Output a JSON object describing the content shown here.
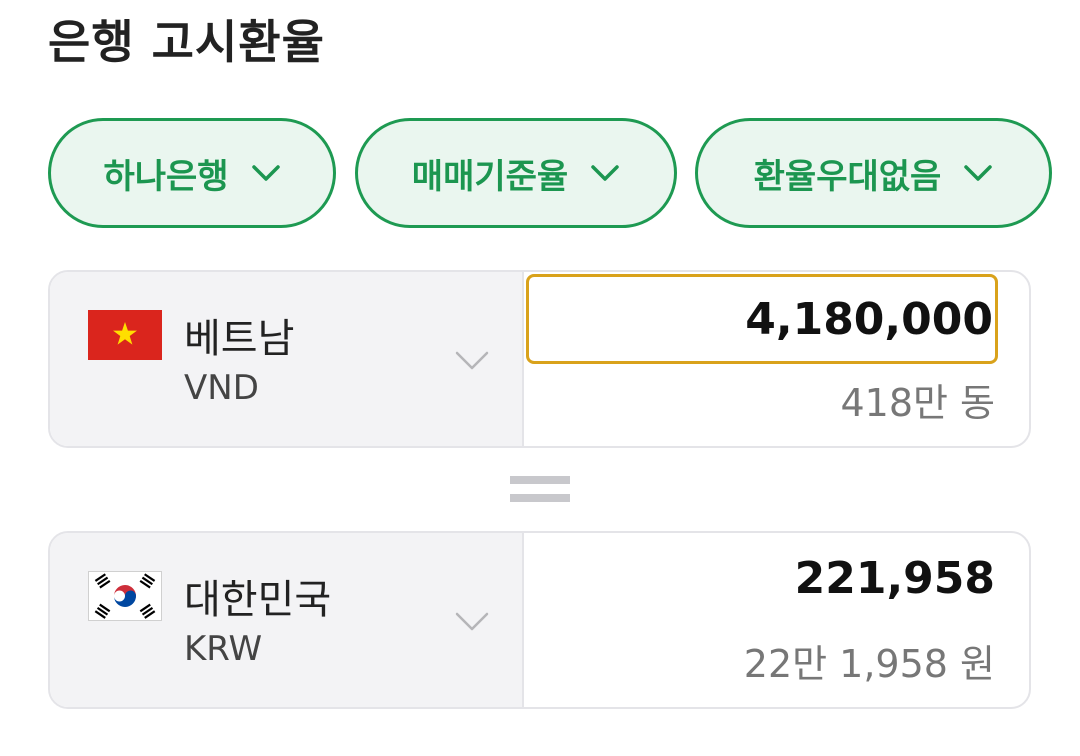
{
  "page": {
    "title": "은행 고시환율"
  },
  "filters": [
    {
      "label": "하나은행",
      "icon": "chevron-down-icon"
    },
    {
      "label": "매매기준율",
      "icon": "chevron-down-icon"
    },
    {
      "label": "환율우대없음",
      "icon": "chevron-down-icon"
    }
  ],
  "from": {
    "country": "베트남",
    "code": "VND",
    "flag_icon": "vietnam-flag-icon",
    "amount": "4,180,000",
    "amount_text": "418만 동"
  },
  "to": {
    "country": "대한민국",
    "code": "KRW",
    "flag_icon": "korea-flag-icon",
    "amount": "221,958",
    "amount_text": "22만 1,958 원"
  },
  "colors": {
    "accent_green": "#1e9a52",
    "chip_bg": "#eaf6ef",
    "input_border": "#d9a21b",
    "vn_red": "#da251d",
    "vn_star": "#ffde00"
  }
}
